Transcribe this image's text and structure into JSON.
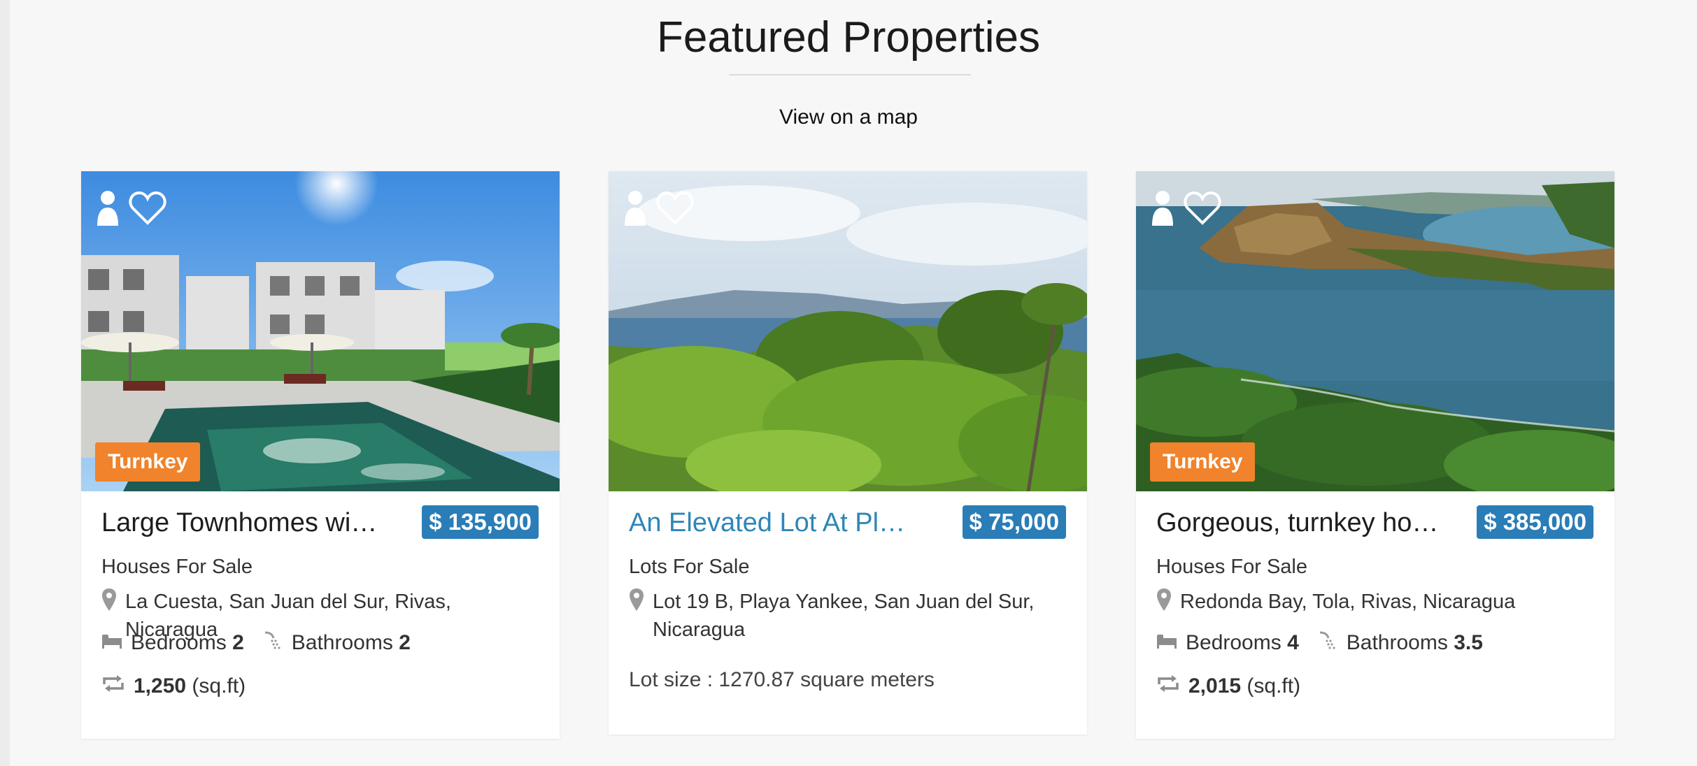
{
  "header": {
    "title": "Featured Properties",
    "map_link": "View on a map"
  },
  "colors": {
    "accent_blue": "#2a7db6",
    "badge_orange": "#f0832b",
    "link_blue": "#2e86b8"
  },
  "cards": [
    {
      "image": "townhomes-pool-photo",
      "badge": "Turnkey",
      "name": "Large Townhomes wi…",
      "price": "$ 135,900",
      "category": "Houses For Sale",
      "location": "La Cuesta, San Juan del Sur, Rivas, Nicaragua",
      "bedrooms_label": "Bedrooms",
      "bedrooms": "2",
      "bathrooms_label": "Bathrooms",
      "bathrooms": "2",
      "area": "1,250",
      "area_unit": "(sq.ft)"
    },
    {
      "image": "ocean-view-lot-photo",
      "name": "An Elevated Lot At Pl…",
      "price": "$ 75,000",
      "category": "Lots For Sale",
      "location": "Lot 19 B, Playa Yankee, San Juan del Sur, Nicaragua",
      "lot_size": "Lot size : 1270.87 square meters"
    },
    {
      "image": "bay-aerial-photo",
      "badge": "Turnkey",
      "name": "Gorgeous, turnkey ho…",
      "price": "$ 385,000",
      "category": "Houses For Sale",
      "location": "Redonda Bay, Tola, Rivas, Nicaragua",
      "bedrooms_label": "Bedrooms",
      "bedrooms": "4",
      "bathrooms_label": "Bathrooms",
      "bathrooms": "3.5",
      "area": "2,015",
      "area_unit": "(sq.ft)"
    }
  ]
}
